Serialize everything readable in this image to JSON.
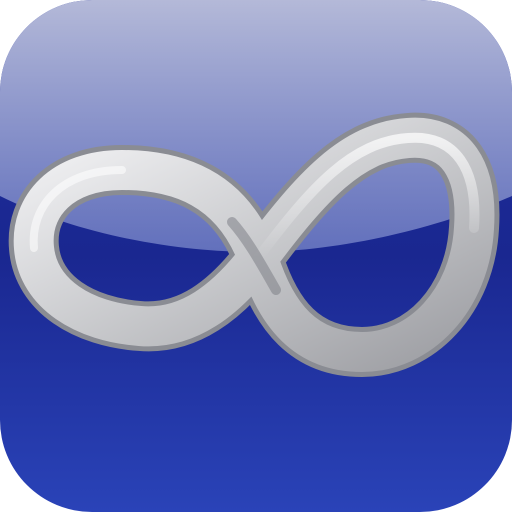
{
  "icon": {
    "name": "infinity-icon",
    "colors": {
      "background_top": "#1f2f9e",
      "background_mid": "#1a2790",
      "background_bottom": "#2a43b8",
      "gloss_top": "#b4b9d8",
      "gloss_bottom": "#6f7dc4",
      "ribbon_light": "#f4f4f6",
      "ribbon_mid": "#c9cacd",
      "ribbon_dark": "#9d9ea3",
      "ribbon_outline": "#8a8c93"
    }
  }
}
